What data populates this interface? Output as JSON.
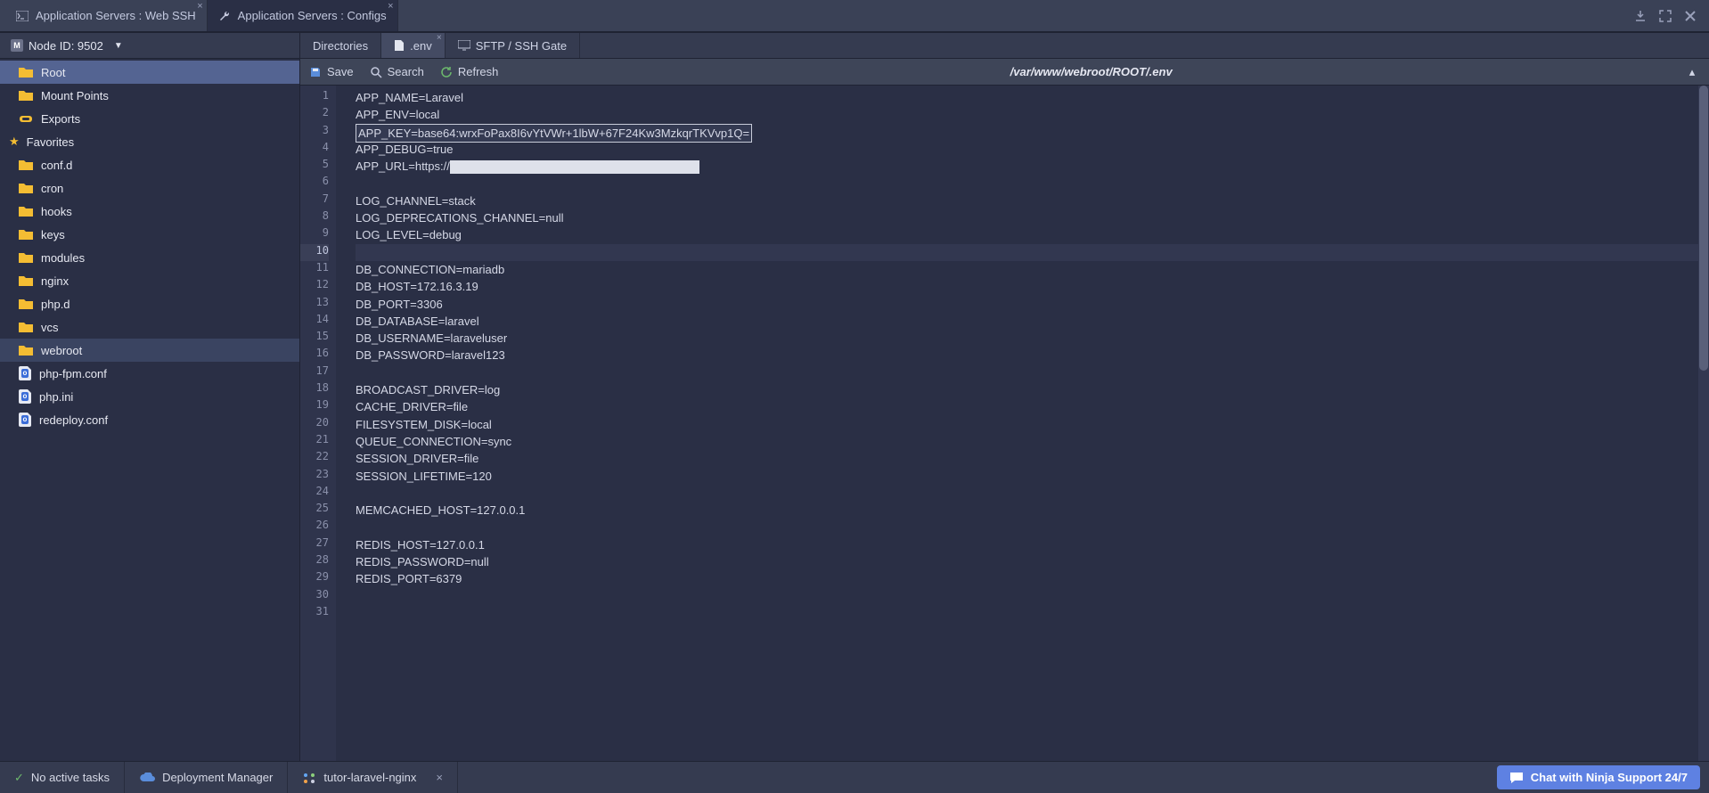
{
  "mainTabs": [
    {
      "label": "Application Servers : Web SSH"
    },
    {
      "label": "Application Servers : Configs"
    }
  ],
  "sidebar": {
    "nodeDropdown": "Node ID: 9502",
    "items": {
      "root": "Root",
      "mount": "Mount Points",
      "exports": "Exports",
      "favorites": "Favorites",
      "confd": "conf.d",
      "cron": "cron",
      "hooks": "hooks",
      "keys": "keys",
      "modules": "modules",
      "nginx": "nginx",
      "phpd": "php.d",
      "vcs": "vcs",
      "webroot": "webroot",
      "phpfpm": "php-fpm.conf",
      "phpini": "php.ini",
      "redeploy": "redeploy.conf"
    }
  },
  "editor": {
    "tabs": {
      "dirs": "Directories",
      "env": ".env",
      "sftp": "SFTP / SSH Gate"
    },
    "toolbar": {
      "save": "Save",
      "search": "Search",
      "refresh": "Refresh"
    },
    "path": "/var/www/webroot/ROOT/.env",
    "lines": [
      "APP_NAME=Laravel",
      "APP_ENV=local",
      "APP_KEY=base64:wrxFoPax8I6vYtVWr+1lbW+67F24Kw3MzkqrTKVvp1Q=",
      "APP_DEBUG=true",
      "APP_URL=https://",
      "",
      "LOG_CHANNEL=stack",
      "LOG_DEPRECATIONS_CHANNEL=null",
      "LOG_LEVEL=debug",
      "",
      "DB_CONNECTION=mariadb",
      "DB_HOST=172.16.3.19",
      "DB_PORT=3306",
      "DB_DATABASE=laravel",
      "DB_USERNAME=laraveluser",
      "DB_PASSWORD=laravel123",
      "",
      "BROADCAST_DRIVER=log",
      "CACHE_DRIVER=file",
      "FILESYSTEM_DISK=local",
      "QUEUE_CONNECTION=sync",
      "SESSION_DRIVER=file",
      "SESSION_LIFETIME=120",
      "",
      "MEMCACHED_HOST=127.0.0.1",
      "",
      "REDIS_HOST=127.0.0.1",
      "REDIS_PASSWORD=null",
      "REDIS_PORT=6379",
      "",
      ""
    ]
  },
  "bottom": {
    "tasks": "No active tasks",
    "dep": "Deployment Manager",
    "env": "tutor-laravel-nginx",
    "chat": "Chat with Ninja Support 24/7"
  }
}
